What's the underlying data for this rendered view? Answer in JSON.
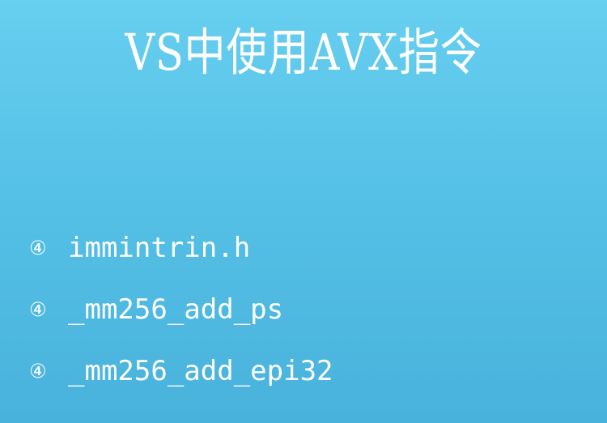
{
  "slide": {
    "title": "VS中使用AVX指令",
    "bullet_icon": "④",
    "bullets": [
      {
        "text": "immintrin.h"
      },
      {
        "text": "_mm256_add_ps"
      },
      {
        "text": "_mm256_add_epi32"
      }
    ]
  },
  "colors": {
    "background_top": "#67cff0",
    "background_bottom": "#48b2dc",
    "text": "#ffffff"
  }
}
